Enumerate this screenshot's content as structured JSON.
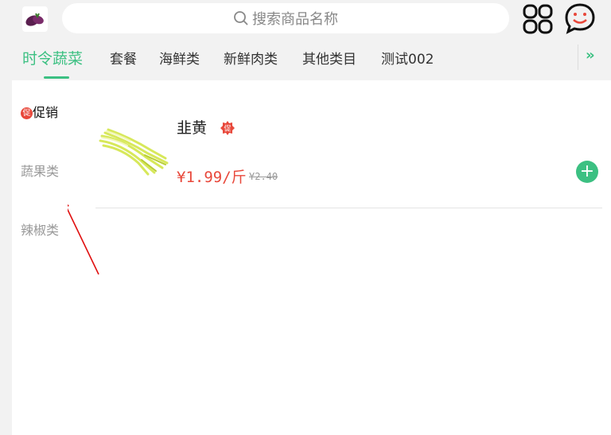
{
  "search": {
    "placeholder": "搜索商品名称"
  },
  "icons": {
    "logo": "purple-sweet-potato-logo",
    "search": "magnifier-icon",
    "apps": "apps-grid-icon",
    "chat": "chat-smile-icon",
    "more": "double-chevron-right-icon",
    "add": "plus-icon"
  },
  "tabs": [
    {
      "label": "时令蔬菜",
      "active": true
    },
    {
      "label": "套餐"
    },
    {
      "label": "海鲜类"
    },
    {
      "label": "新鲜肉类"
    },
    {
      "label": "其他类目"
    },
    {
      "label": "测试002"
    }
  ],
  "sidebar": {
    "items": [
      {
        "label": "促销",
        "badge": "促",
        "active": true
      },
      {
        "label": "蔬果类"
      },
      {
        "label": "辣椒类"
      }
    ]
  },
  "product": {
    "name": "韭黄",
    "badge": "促",
    "price": "¥1.99/斤",
    "old_price": "¥2.40"
  },
  "colors": {
    "accent": "#3cc082",
    "price": "#e8483b",
    "badge": "#e8483b"
  }
}
